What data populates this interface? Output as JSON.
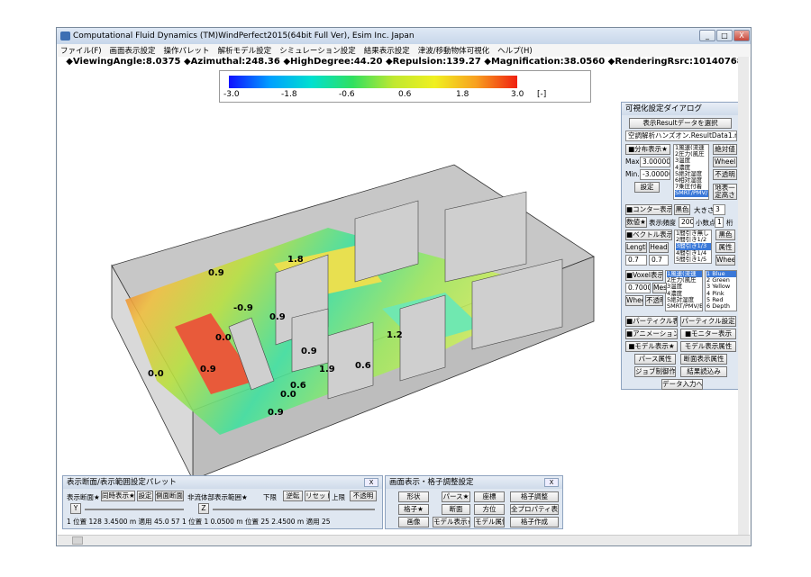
{
  "window": {
    "title": "Computational Fluid Dynamics (TM)WindPerfect2015(64bit Full Ver), Esim Inc. Japan",
    "min": "_",
    "max": "□",
    "close": "X"
  },
  "menu": [
    "ファイル(F)",
    "画面表示設定",
    "操作パレット",
    "解析モデル設定",
    "シミュレーション設定",
    "結果表示設定",
    "津波/移動物体可視化",
    "ヘルプ(H)"
  ],
  "status_line": "◆ViewingAngle:8.0375 ◆Azimuthal:248.36 ◆HighDegree:44.20 ◆Repulsion:139.27 ◆Magnification:38.0560 ◆RenderingRsrc:10140768",
  "colorbar": {
    "ticks": [
      "-3.0",
      "-1.8",
      "-0.6",
      "0.6",
      "1.8",
      "3.0"
    ],
    "unit": "[-]"
  },
  "contour_labels": [
    "0.9",
    "1.8",
    "-0.9",
    "0.9",
    "1.9",
    "0.0",
    "0.9",
    "0.9",
    "1.2",
    "0.6",
    "0.6",
    "0.0",
    "0.9",
    "0.0"
  ],
  "dialog": {
    "title": "可視化設定ダイアログ",
    "select_btn": "表示Resultデータを選択",
    "file": "空調解析ハンズオン.ResultData1.rst",
    "dist_btn": "■分布表示★",
    "max_label": "Max.",
    "max_val": "3.00000",
    "min_label": "Min.",
    "min_val": "-3.00000",
    "set_btn": "設定",
    "dist_list": [
      "1風速(流速",
      "2圧力(風圧",
      "3温度",
      "4濃度",
      "5絶対湿度",
      "6相対湿度",
      "7乗圧付着",
      "SMRT/PMV/"
    ],
    "abs_btn": "絶対値",
    "wheel": "Wheel",
    "opaque": "不透明",
    "surface": "地表一定高さ",
    "contour_btn": "■コンター表示★",
    "black": "黒色",
    "size_label": "大きさ",
    "size_val": "3",
    "num_btn": "数値★",
    "freq_label": "表示頻度",
    "freq_val": "200",
    "dec_label": "小数点",
    "dec_val": "1",
    "digit": "桁",
    "vector_btn": "■ベクトル表示★",
    "vec_list": [
      "1間引き無し",
      "2間引き1/2",
      "3間引き1/3",
      "4間引き1/4",
      "5間引き1/5"
    ],
    "length": "Length",
    "head": "Head",
    "black2": "黒色",
    "attr": "属性",
    "len_val": "0.7",
    "head_val": "0.7",
    "wheel2": "Wheel",
    "voxel_btn": "■Voxel表示",
    "voxel_list": [
      "1風速(流速",
      "2圧力(風圧",
      "3温度",
      "4濃度",
      "5絶対湿度",
      "SMRT/PMV/B"
    ],
    "color_list": [
      "1 Blue",
      "2 Green",
      "3 Yellow",
      "4 Pink",
      "5 Red",
      "6 Depth"
    ],
    "voxel_val": "0.70000",
    "mesh": "Mesh",
    "wheel3": "Wheel",
    "opaque2": "不透明",
    "particle_btn": "■パーティクル表示",
    "particle_set": "パーティクル設定",
    "anim_btn": "■アニメーション表示",
    "monitor_btn": "■モニター表示",
    "model_btn": "■モデル表示★",
    "model_attr": "モデル表示属性",
    "perse_attr": "パース属性",
    "section_attr": "断面表示属性",
    "job_btn": "ジョブ制御作結果",
    "load_btn": "結果読込み",
    "data_btn": "データ入力へ"
  },
  "pal1": {
    "title": "表示断面/表示範囲設定パレット",
    "disp_sec": "表示断面★",
    "sync": "同時表示★",
    "set": "設定",
    "rev": "側面断面",
    "fluid": "非流体部表示範囲★",
    "lower": "下限",
    "upper": "上限",
    "reverse": "逆転",
    "reset": "リセット",
    "opaque": "不透明",
    "y": "Y",
    "z": "Z",
    "row": "1 位置 128 3.4500 m 適用 45.0 57 1 位置 1 0.0500 m 位置 25 2.4500 m 適用 25"
  },
  "pal2": {
    "title": "画面表示・格子調整設定",
    "shape": "形状",
    "perse": "パース★",
    "coord": "座標",
    "grid_adj": "格子調整",
    "grid": "格子★",
    "section": "断面",
    "dir": "方位",
    "all": "全プロパティ表示★",
    "image": "画像",
    "model_disp": "モデル表示★",
    "model_attr": "モデル属性",
    "grid_make": "格子作成"
  }
}
